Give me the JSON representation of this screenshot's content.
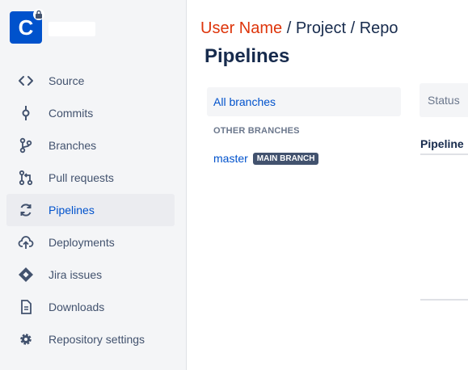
{
  "repo": {
    "logo_letter": "C"
  },
  "sidebar": {
    "items": [
      {
        "label": "Source",
        "icon": "source-code-icon",
        "active": false
      },
      {
        "label": "Commits",
        "icon": "commit-icon",
        "active": false
      },
      {
        "label": "Branches",
        "icon": "branch-icon",
        "active": false
      },
      {
        "label": "Pull requests",
        "icon": "pull-request-icon",
        "active": false
      },
      {
        "label": "Pipelines",
        "icon": "pipelines-icon",
        "active": true
      },
      {
        "label": "Deployments",
        "icon": "cloud-upload-icon",
        "active": false
      },
      {
        "label": "Jira issues",
        "icon": "jira-icon",
        "active": false
      },
      {
        "label": "Downloads",
        "icon": "document-icon",
        "active": false
      },
      {
        "label": "Repository settings",
        "icon": "gear-icon",
        "active": false
      }
    ]
  },
  "breadcrumb": {
    "user": "User Name",
    "sep1": " / ",
    "project": "Project",
    "sep2": " / ",
    "repo": "Repo"
  },
  "page": {
    "title": "Pipelines"
  },
  "branches": {
    "all_label": "All branches",
    "other_label": "OTHER BRANCHES",
    "items": [
      {
        "name": "master",
        "badge": "MAIN BRANCH"
      }
    ]
  },
  "filters": {
    "status_label": "Status"
  },
  "table": {
    "columns": [
      "Pipeline"
    ]
  },
  "colors": {
    "accent": "#0052cc",
    "sidebar_bg": "#f4f5f7",
    "breadcrumb_user": "#de350b",
    "badge_bg": "#42526e"
  }
}
